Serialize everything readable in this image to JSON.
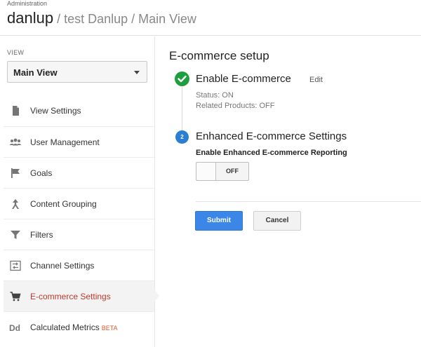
{
  "header": {
    "admin_label": "Administration",
    "account": "danlup",
    "property": " / test Danlup",
    "view": " / Main View"
  },
  "sidebar": {
    "view_label": "VIEW",
    "view_selected": "Main View",
    "items": [
      {
        "label": "View Settings",
        "icon": "document-icon"
      },
      {
        "label": "User Management",
        "icon": "users-icon"
      },
      {
        "label": "Goals",
        "icon": "flag-icon"
      },
      {
        "label": "Content Grouping",
        "icon": "grouping-icon"
      },
      {
        "label": "Filters",
        "icon": "filter-icon"
      },
      {
        "label": "Channel Settings",
        "icon": "channel-icon"
      },
      {
        "label": "E-commerce Settings",
        "icon": "cart-icon",
        "active": true
      },
      {
        "label": "Calculated Metrics",
        "icon": "dd-icon",
        "badge": "BETA"
      }
    ]
  },
  "main": {
    "title": "E-commerce setup",
    "step1": {
      "title": "Enable E-commerce",
      "edit": "Edit",
      "status": "Status: ON",
      "related": "Related Products: OFF"
    },
    "step2": {
      "number": "2",
      "title": "Enhanced E-commerce Settings",
      "label": "Enable Enhanced E-commerce Reporting",
      "toggle_state": "OFF"
    },
    "submit": "Submit",
    "cancel": "Cancel"
  },
  "colors": {
    "accent_blue": "#3b86e6",
    "check_green": "#1e9e3e",
    "active_red": "#c0392b",
    "beta_orange": "#e0592a"
  }
}
